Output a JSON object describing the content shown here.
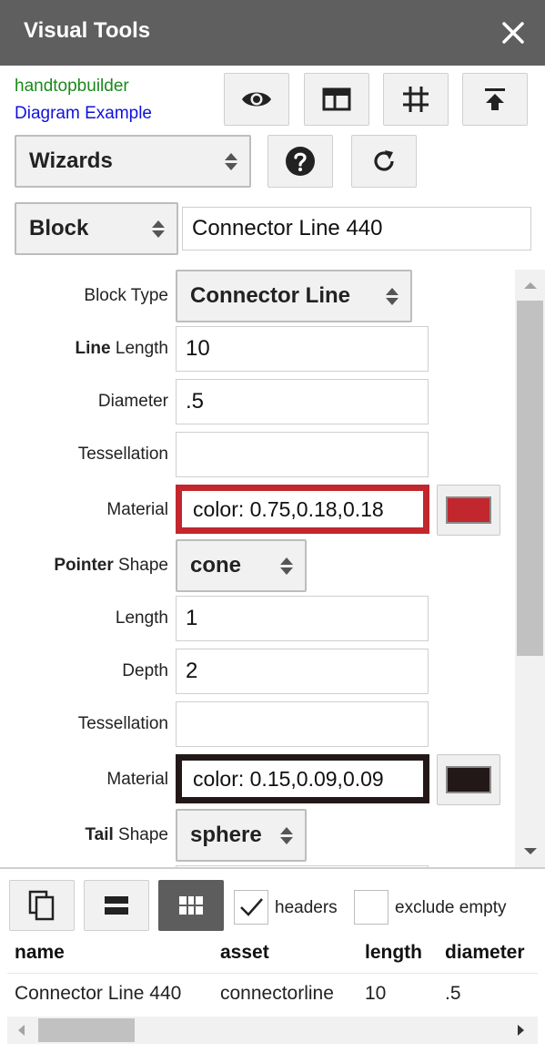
{
  "window": {
    "title": "Visual Tools",
    "close_icon": "close-icon"
  },
  "links": {
    "builder": "handtopbuilder",
    "example": "Diagram Example",
    "builder_color": "#1a8a1a",
    "example_color": "#1111dd"
  },
  "toolbar": {
    "icons": [
      "eye-icon",
      "layout-icon",
      "grid-icon",
      "upload-icon",
      "help-icon",
      "refresh-icon"
    ]
  },
  "wizards": {
    "selected": "Wizards"
  },
  "block": {
    "kind": "Block",
    "name_value": "Connector Line 440"
  },
  "properties": {
    "block_type": {
      "label": "Block Type",
      "value": "Connector Line"
    },
    "line_length": {
      "label_bold": "Line",
      "label_rest": " Length",
      "value": "10"
    },
    "diameter": {
      "label": "Diameter",
      "value": ".5"
    },
    "tessellation": {
      "label": "Tessellation",
      "value": ""
    },
    "material": {
      "label": "Material",
      "value": "color: 0.75,0.18,0.18",
      "color": "#c1272d"
    },
    "pointer_shape": {
      "label_bold": "Pointer",
      "label_rest": " Shape",
      "value": "cone"
    },
    "pointer_length": {
      "label": "Length",
      "value": "1"
    },
    "pointer_depth": {
      "label": "Depth",
      "value": "2"
    },
    "pointer_tessellation": {
      "label": "Tessellation",
      "value": ""
    },
    "pointer_material": {
      "label": "Material",
      "value": "color: 0.15,0.09,0.09",
      "color": "#231818"
    },
    "tail_shape": {
      "label_bold": "Tail",
      "label_rest": " Shape",
      "value": "sphere"
    }
  },
  "bottom_toolbar": {
    "icons": [
      "copy-icon",
      "single-row-icon",
      "table-grid-icon"
    ],
    "headers_checkbox": {
      "label": "headers",
      "checked": true
    },
    "exclude_empty_checkbox": {
      "label": "exclude empty",
      "checked": false
    }
  },
  "table": {
    "columns": [
      "name",
      "asset",
      "length",
      "diameter"
    ],
    "rows": [
      [
        "Connector Line 440",
        "connectorline",
        "10",
        ".5"
      ]
    ]
  }
}
